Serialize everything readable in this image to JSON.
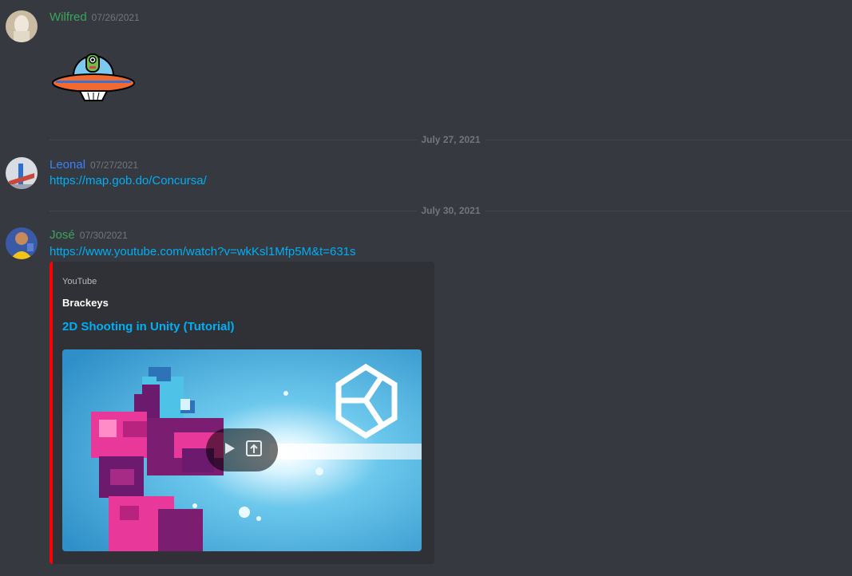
{
  "messages": [
    {
      "author": "Wilfred",
      "timestamp": "07/26/2021",
      "author_color": "#3ba55d"
    },
    {
      "author": "Leonal",
      "timestamp": "07/27/2021",
      "author_color": "#3b82f6",
      "link": "https://map.gob.do/Concursa/"
    },
    {
      "author": "José",
      "timestamp": "07/30/2021",
      "author_color": "#3ba55d",
      "link": "https://www.youtube.com/watch?v=wkKsl1Mfp5M&t=631s"
    }
  ],
  "dividers": [
    "July 27, 2021",
    "July 30, 2021"
  ],
  "embed": {
    "provider": "YouTube",
    "author": "Brackeys",
    "title": "2D Shooting in Unity (Tutorial)",
    "accent_color": "#ff0000"
  },
  "icons": {
    "sticker": "ufo-alien-sticker",
    "play": "play-icon",
    "open": "open-external-icon",
    "logo": "unity-logo-icon"
  }
}
